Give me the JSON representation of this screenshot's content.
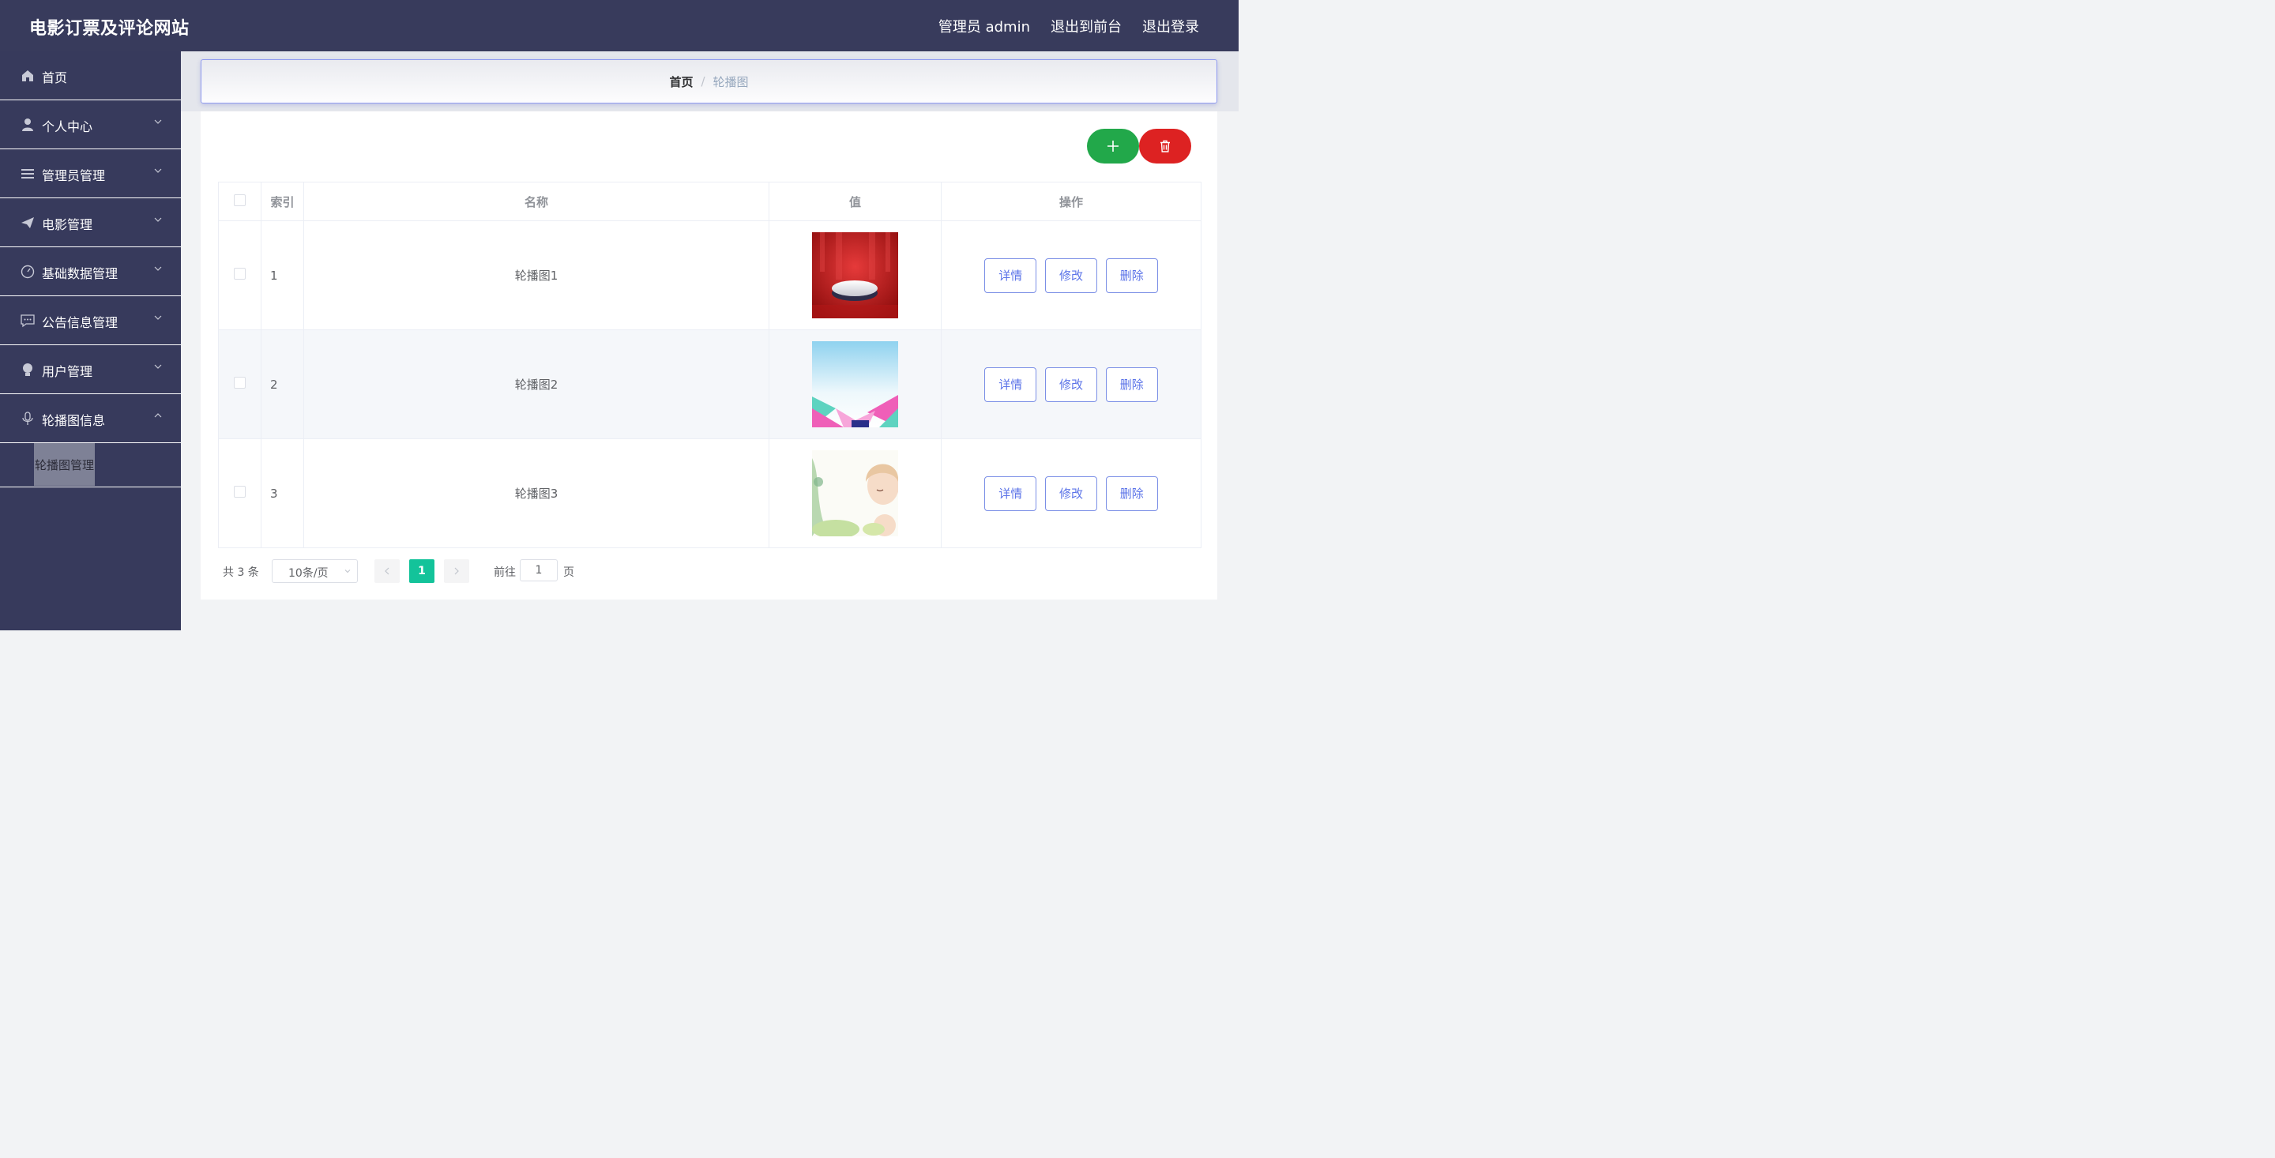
{
  "header": {
    "title": "电影订票及评论网站",
    "admin_label": "管理员 admin",
    "front_label": "退出到前台",
    "logout_label": "退出登录"
  },
  "sidebar": {
    "items": [
      {
        "label": "首页",
        "icon": "home-icon"
      },
      {
        "label": "个人中心",
        "icon": "user-icon"
      },
      {
        "label": "管理员管理",
        "icon": "list-icon"
      },
      {
        "label": "电影管理",
        "icon": "paper-plane-icon"
      },
      {
        "label": "基础数据管理",
        "icon": "gauge-icon"
      },
      {
        "label": "公告信息管理",
        "icon": "chat-icon"
      },
      {
        "label": "用户管理",
        "icon": "bulb-icon"
      },
      {
        "label": "轮播图信息",
        "icon": "microphone-icon"
      }
    ],
    "submenu_label": "轮播图管理"
  },
  "breadcrumb": {
    "home": "首页",
    "separator": "/",
    "current": "轮播图"
  },
  "table": {
    "headers": [
      "索引",
      "名称",
      "值",
      "操作"
    ],
    "rows": [
      {
        "index": "1",
        "name": "轮播图1"
      },
      {
        "index": "2",
        "name": "轮播图2"
      },
      {
        "index": "3",
        "name": "轮播图3"
      }
    ],
    "actions": {
      "detail": "详情",
      "edit": "修改",
      "delete": "删除"
    }
  },
  "pagination": {
    "total": "共 3 条",
    "page_size": "10条/页",
    "current_page": "1",
    "goto_label": "前往",
    "goto_value": "1",
    "page_suffix": "页"
  },
  "colors": {
    "header_bg": "#383b5c",
    "add_button": "#22a84a",
    "delete_button": "#dd2222",
    "accent_blue": "#5b73e8",
    "active_page": "#13c39a"
  }
}
